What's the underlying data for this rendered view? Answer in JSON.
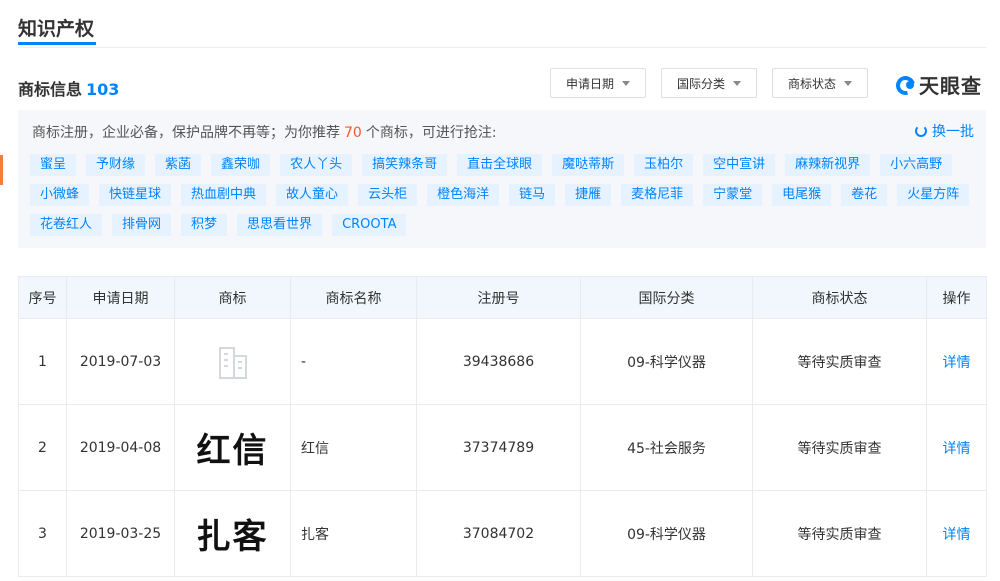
{
  "page": {
    "title": "知识产权"
  },
  "section": {
    "label": "商标信息",
    "count": "103"
  },
  "filters": [
    {
      "label": "申请日期"
    },
    {
      "label": "国际分类"
    },
    {
      "label": "商标状态"
    }
  ],
  "brand": {
    "logo_text": "天眼查"
  },
  "promo": {
    "text_before": "商标注册，企业必备，保护品牌不再等；为你推荐",
    "highlight": "70",
    "text_after": "个商标，可进行抢注:",
    "refresh_label": "换一批",
    "tag_rows": [
      [
        "蜜呈",
        "予财缘",
        "紫菡",
        "鑫荣咖",
        "农人丫头",
        "搞笑辣条哥",
        "直击全球眼",
        "魔哒蒂斯",
        "玉柏尔",
        "空中宣讲",
        "麻辣新视界",
        "小六高野"
      ],
      [
        "小微蜂",
        "快链星球",
        "热血剧中典",
        "故人童心",
        "云头柜",
        "橙色海洋",
        "链马",
        "捷雁",
        "麦格尼菲",
        "宁蒙堂",
        "电尾猴",
        "卷花",
        "火星方阵"
      ],
      [
        "花卷红人",
        "排骨网",
        "积梦",
        "思思看世界",
        "CROOTA"
      ]
    ]
  },
  "table": {
    "headers": [
      "序号",
      "申请日期",
      "商标",
      "商标名称",
      "注册号",
      "国际分类",
      "商标状态",
      "操作"
    ],
    "rows": [
      {
        "no": "1",
        "date": "2019-07-03",
        "mark": "",
        "name": "-",
        "reg_no": "39438686",
        "class": "09-科学仪器",
        "status": "等待实质审查",
        "action": "详情"
      },
      {
        "no": "2",
        "date": "2019-04-08",
        "mark": "红信",
        "name": "红信",
        "reg_no": "37374789",
        "class": "45-社会服务",
        "status": "等待实质审查",
        "action": "详情"
      },
      {
        "no": "3",
        "date": "2019-03-25",
        "mark": "扎客",
        "name": "扎客",
        "reg_no": "37084702",
        "class": "09-科学仪器",
        "status": "等待实质审查",
        "action": "详情"
      }
    ]
  }
}
